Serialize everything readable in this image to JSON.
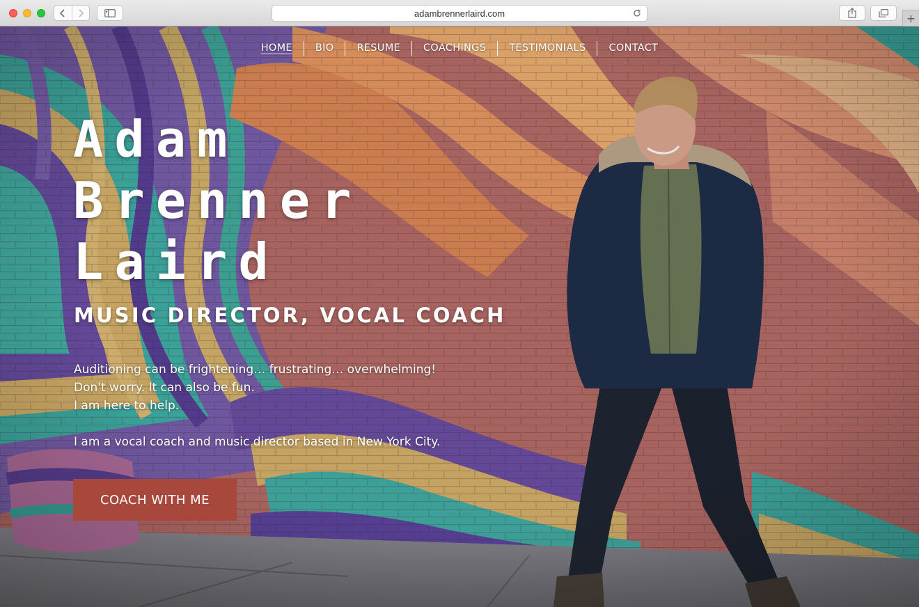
{
  "browser": {
    "url": "adambrennerlaird.com",
    "icons": [
      "back-arrow-icon",
      "forward-arrow-icon",
      "sidebar-icon",
      "reload-icon",
      "share-icon",
      "tabs-icon",
      "plus-icon"
    ]
  },
  "nav": {
    "items": [
      {
        "label": "HOME",
        "active": true
      },
      {
        "label": "BIO"
      },
      {
        "label": "RESUME"
      },
      {
        "label": "COACHINGS"
      },
      {
        "label": "TESTIMONIALS"
      },
      {
        "label": "CONTACT"
      }
    ]
  },
  "hero": {
    "name_lines": [
      "Adam",
      "Brenner",
      "Laird"
    ],
    "subtitle": "MUSIC DIRECTOR, VOCAL COACH",
    "intro_lines": [
      "Auditioning can be frightening… frustrating… overwhelming!",
      "Don't worry. It can also be fun.",
      "I am here to help."
    ],
    "about": "I am a vocal coach and music director based in New York City.",
    "cta_label": "COACH WITH ME"
  },
  "colors": {
    "cta": "#a8483d",
    "text": "#ffffff"
  }
}
